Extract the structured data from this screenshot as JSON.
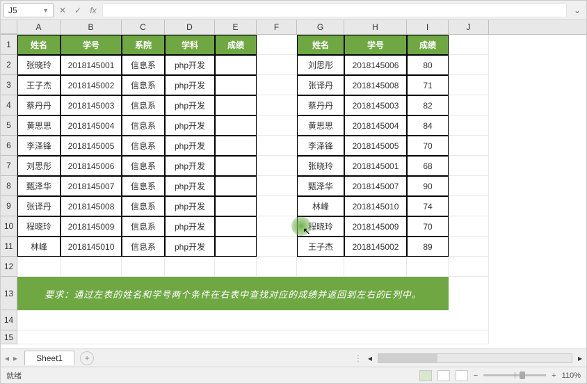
{
  "name_box": "J5",
  "formula": "",
  "columns": [
    "A",
    "B",
    "C",
    "D",
    "E",
    "F",
    "G",
    "H",
    "I",
    "J"
  ],
  "left_headers": [
    "姓名",
    "学号",
    "系院",
    "学科",
    "成绩"
  ],
  "right_headers": [
    "姓名",
    "学号",
    "成绩"
  ],
  "left_rows": [
    {
      "name": "张晓玲",
      "id": "2018145001",
      "dept": "信息系",
      "subj": "php开发",
      "score": ""
    },
    {
      "name": "王子杰",
      "id": "2018145002",
      "dept": "信息系",
      "subj": "php开发",
      "score": ""
    },
    {
      "name": "蔡丹丹",
      "id": "2018145003",
      "dept": "信息系",
      "subj": "php开发",
      "score": ""
    },
    {
      "name": "黄思思",
      "id": "2018145004",
      "dept": "信息系",
      "subj": "php开发",
      "score": ""
    },
    {
      "name": "李泽锋",
      "id": "2018145005",
      "dept": "信息系",
      "subj": "php开发",
      "score": ""
    },
    {
      "name": "刘思彤",
      "id": "2018145006",
      "dept": "信息系",
      "subj": "php开发",
      "score": ""
    },
    {
      "name": "甄泽华",
      "id": "2018145007",
      "dept": "信息系",
      "subj": "php开发",
      "score": ""
    },
    {
      "name": "张译丹",
      "id": "2018145008",
      "dept": "信息系",
      "subj": "php开发",
      "score": ""
    },
    {
      "name": "程晓玲",
      "id": "2018145009",
      "dept": "信息系",
      "subj": "php开发",
      "score": ""
    },
    {
      "name": "林峰",
      "id": "2018145010",
      "dept": "信息系",
      "subj": "php开发",
      "score": ""
    }
  ],
  "right_rows": [
    {
      "name": "刘思彤",
      "id": "2018145006",
      "score": "80"
    },
    {
      "name": "张译丹",
      "id": "2018145008",
      "score": "71"
    },
    {
      "name": "蔡丹丹",
      "id": "2018145003",
      "score": "82"
    },
    {
      "name": "黄思思",
      "id": "2018145004",
      "score": "84"
    },
    {
      "name": "李泽锋",
      "id": "2018145005",
      "score": "70"
    },
    {
      "name": "张晓玲",
      "id": "2018145001",
      "score": "68"
    },
    {
      "name": "甄泽华",
      "id": "2018145007",
      "score": "90"
    },
    {
      "name": "林峰",
      "id": "2018145010",
      "score": "74"
    },
    {
      "name": "程晓玲",
      "id": "2018145009",
      "score": "70"
    },
    {
      "name": "王子杰",
      "id": "2018145002",
      "score": "89"
    }
  ],
  "note": "要求：通过左表的姓名和学号两个条件在右表中查找对应的成绩并返回到左右的E列中。",
  "sheet_tab": "Sheet1",
  "status": "就绪",
  "zoom": "110%",
  "colors": {
    "accent": "#6fa843"
  }
}
